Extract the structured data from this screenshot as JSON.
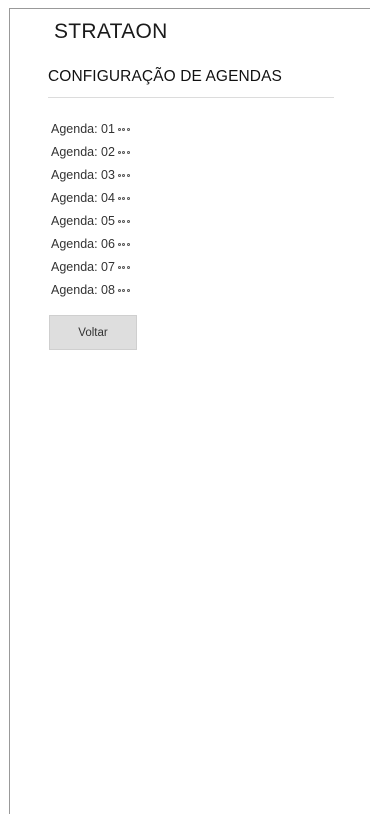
{
  "brand": "STRATAON",
  "section_title": "CONFIGURAÇÃO DE AGENDAS",
  "agendas": [
    {
      "label": "Agenda: 01",
      "menu_icon": "more-dots-icon"
    },
    {
      "label": "Agenda: 02",
      "menu_icon": "more-dots-icon"
    },
    {
      "label": "Agenda: 03",
      "menu_icon": "more-dots-icon"
    },
    {
      "label": "Agenda: 04",
      "menu_icon": "more-dots-icon"
    },
    {
      "label": "Agenda: 05",
      "menu_icon": "more-dots-icon"
    },
    {
      "label": "Agenda: 06",
      "menu_icon": "more-dots-icon"
    },
    {
      "label": "Agenda: 07",
      "menu_icon": "more-dots-icon"
    },
    {
      "label": "Agenda: 08",
      "menu_icon": "more-dots-icon"
    }
  ],
  "back_button": {
    "label": "Voltar"
  },
  "colors": {
    "button_bg": "#dedede",
    "divider": "#dcdcdc",
    "frame_border": "#999999"
  }
}
